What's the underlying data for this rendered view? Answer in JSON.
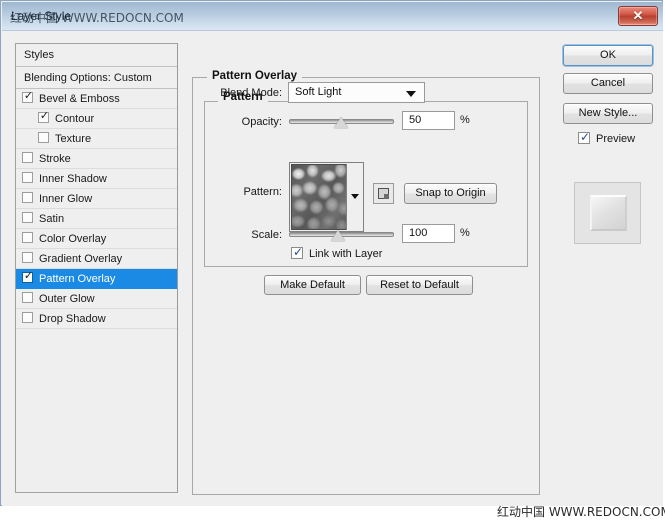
{
  "window": {
    "title": "Layer Style",
    "title_watermark": "红动中国 WWW.REDOCN.COM",
    "close_icon": "close-icon",
    "close_glyph": "✕"
  },
  "watermark": {
    "bottom_right": "红动中国 WWW.REDOCN.COM"
  },
  "styles_list": {
    "header": "Styles",
    "blending_options": "Blending Options: Custom",
    "items": [
      {
        "label": "Bevel & Emboss",
        "checked": true,
        "indent": false,
        "selected": false
      },
      {
        "label": "Contour",
        "checked": true,
        "indent": true,
        "selected": false
      },
      {
        "label": "Texture",
        "checked": false,
        "indent": true,
        "selected": false
      },
      {
        "label": "Stroke",
        "checked": false,
        "indent": false,
        "selected": false
      },
      {
        "label": "Inner Shadow",
        "checked": false,
        "indent": false,
        "selected": false
      },
      {
        "label": "Inner Glow",
        "checked": false,
        "indent": false,
        "selected": false
      },
      {
        "label": "Satin",
        "checked": false,
        "indent": false,
        "selected": false
      },
      {
        "label": "Color Overlay",
        "checked": false,
        "indent": false,
        "selected": false
      },
      {
        "label": "Gradient Overlay",
        "checked": false,
        "indent": false,
        "selected": false
      },
      {
        "label": "Pattern Overlay",
        "checked": true,
        "indent": false,
        "selected": true
      },
      {
        "label": "Outer Glow",
        "checked": false,
        "indent": false,
        "selected": false
      },
      {
        "label": "Drop Shadow",
        "checked": false,
        "indent": false,
        "selected": false
      }
    ]
  },
  "panel": {
    "group_title": "Pattern Overlay",
    "sub_group_title": "Pattern",
    "blend_mode": {
      "label": "Blend Mode:",
      "value": "Soft Light",
      "arrow_icon": "chevron-down-icon"
    },
    "opacity": {
      "label": "Opacity:",
      "value": "50",
      "unit": "%",
      "slider_percent": 50
    },
    "pattern": {
      "label": "Pattern:",
      "swatch_icon": "pattern-swatch",
      "dropdown_icon": "chevron-down-icon",
      "new_preset_icon": "new-preset-icon",
      "snap_button": "Snap to Origin"
    },
    "scale": {
      "label": "Scale:",
      "value": "100",
      "unit": "%",
      "slider_percent": 47
    },
    "link_with_layer": {
      "label": "Link with Layer",
      "checked": true
    },
    "make_default": "Make Default",
    "reset_to_default": "Reset to Default"
  },
  "actions": {
    "ok": "OK",
    "cancel": "Cancel",
    "new_style": "New Style...",
    "preview": {
      "label": "Preview",
      "checked": true
    }
  },
  "colors": {
    "accent_selection": "#1a8ae5",
    "titlebar_top": "#9fb7cf",
    "close_button": "#b8402f",
    "dialog_bg": "#efefef"
  }
}
